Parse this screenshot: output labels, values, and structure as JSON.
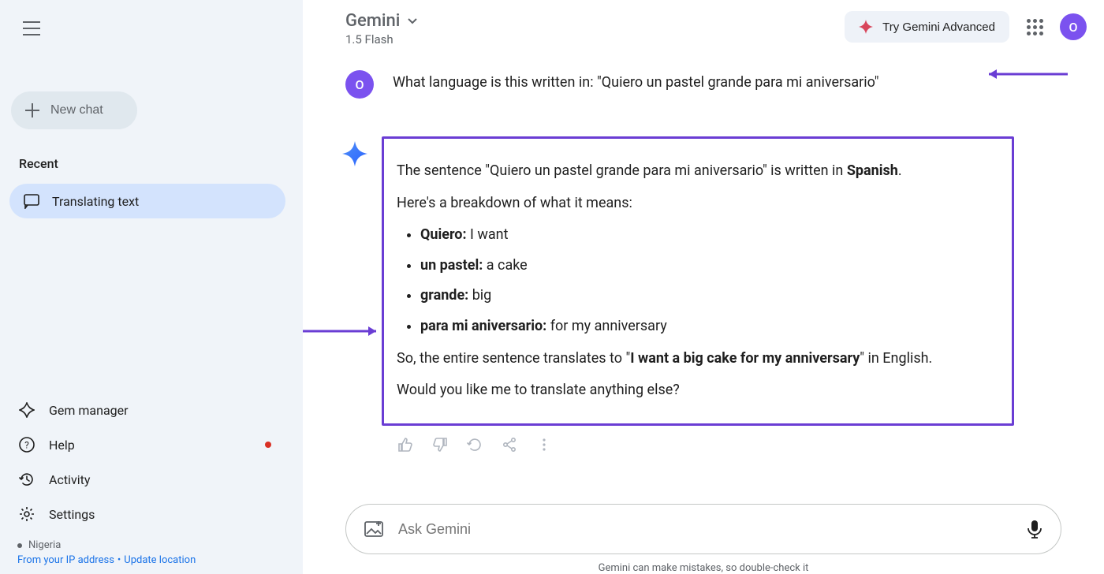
{
  "sidebar": {
    "new_chat": "New chat",
    "recent_label": "Recent",
    "recent_item": "Translating text",
    "nav": {
      "gem_manager": "Gem manager",
      "help": "Help",
      "activity": "Activity",
      "settings": "Settings"
    },
    "location": {
      "country": "Nigeria",
      "ip_text": "From your IP address",
      "update": "Update location"
    }
  },
  "header": {
    "title": "Gemini",
    "subtitle": "1.5 Flash",
    "try_advanced": "Try Gemini Advanced",
    "avatar_initial": "O"
  },
  "conversation": {
    "user_initial": "O",
    "user_message": "What language is this written in: \"Quiero un pastel grande para mi aniversario\"",
    "response": {
      "intro_prefix": "The sentence \"Quiero un pastel grande para mi aniversario\" is written in ",
      "intro_bold": "Spanish",
      "intro_suffix": ".",
      "breakdown_label": "Here's a breakdown of what it means:",
      "items": [
        {
          "term": "Quiero:",
          "def": " I want"
        },
        {
          "term": "un pastel:",
          "def": " a cake"
        },
        {
          "term": "grande:",
          "def": " big"
        },
        {
          "term": "para mi aniversario:",
          "def": " for my anniversary"
        }
      ],
      "translation_prefix": "So, the entire sentence translates to \"",
      "translation_bold": "I want a big cake for my anniversary",
      "translation_suffix": "\" in English.",
      "followup": "Would you like me to translate anything else?"
    }
  },
  "input": {
    "placeholder": "Ask Gemini"
  },
  "footer": "Gemini can make mistakes, so double-check it"
}
